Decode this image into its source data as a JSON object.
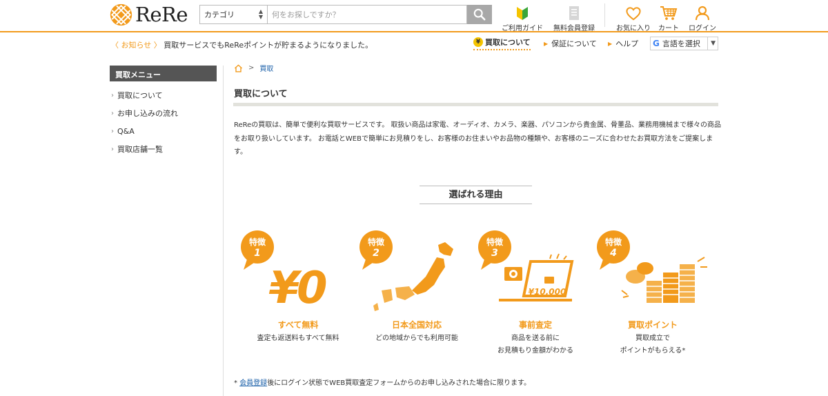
{
  "header": {
    "logo_text": "ReRe",
    "search": {
      "category_label": "カテゴリ",
      "placeholder": "何をお探しですか？"
    },
    "nav": [
      {
        "label": "ご利用ガイド",
        "icon": "beginner-leaf-icon"
      },
      {
        "label": "無料会員登録",
        "icon": "document-icon"
      },
      {
        "label": "お気に入り",
        "icon": "heart-icon"
      },
      {
        "label": "カート",
        "icon": "cart-icon"
      },
      {
        "label": "ログイン",
        "icon": "user-icon"
      }
    ]
  },
  "subbar": {
    "notice_tag": "〈 お知らせ 〉",
    "notice_text": "買取サービスでもReReポイントが貯まるようになりました。",
    "links": {
      "kaitori": "買取について",
      "hosho": "保証について",
      "help": "ヘルプ"
    },
    "yen_symbol": "¥",
    "language": {
      "g": "G",
      "label": "言語を選択"
    }
  },
  "sidebar": {
    "title": "買取メニュー",
    "items": [
      "買取について",
      "お申し込みの流れ",
      "Q&A",
      "買取店舗一覧"
    ]
  },
  "breadcrumb": {
    "current": "買取",
    "separator": ">"
  },
  "main": {
    "title": "買取について",
    "intro": "ReReの買取は、簡単で便利な買取サービスです。 取扱い商品は家電、オーディオ、カメラ、楽器、パソコンから貴金属、骨董品、業務用機械まで様々の商品をお取り扱いしています。 お電話とWEBで簡単にお見積りをし、お客様のお住まいやお品物の種類や、お客様のニーズに合わせたお買取方法をご提案します。",
    "reasons_heading": "選ばれる理由",
    "features": [
      {
        "badge": "特徴",
        "num": "1",
        "art_text": "¥0",
        "title": "すべて無料",
        "desc": [
          "査定も返送料もすべて無料"
        ]
      },
      {
        "badge": "特徴",
        "num": "2",
        "title": "日本全国対応",
        "desc": [
          "どの地域からでも利用可能"
        ]
      },
      {
        "badge": "特徴",
        "num": "3",
        "art_text": "¥10,000",
        "title": "事前査定",
        "desc": [
          "商品を送る前に",
          "お見積もり金額がわかる"
        ]
      },
      {
        "badge": "特徴",
        "num": "4",
        "title": "買取ポイント",
        "desc": [
          "買取成立で",
          "ポイントがもらえる*"
        ]
      }
    ],
    "footnote": {
      "prefix": "* ",
      "link": "会員登録",
      "text": "後にログイン状態でWEB買取査定フォームからのお申し込みされた場合に限ります。"
    }
  },
  "colors": {
    "accent": "#f29a1b",
    "link": "#1a5fa8"
  }
}
